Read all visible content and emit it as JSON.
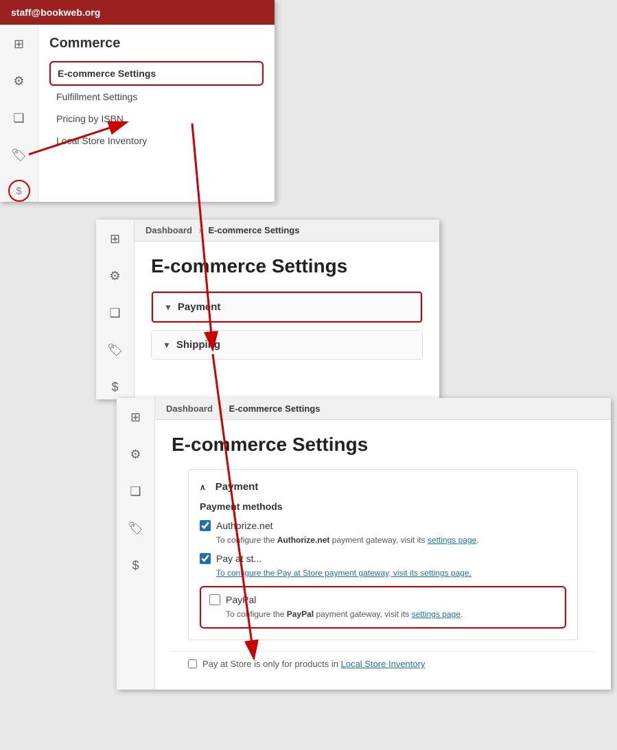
{
  "user": {
    "email": "staff@bookweb.org"
  },
  "sidebar": {
    "icons": [
      {
        "name": "grid-icon",
        "symbol": "⊞",
        "active": false
      },
      {
        "name": "cog-icon",
        "symbol": "⚙",
        "active": false
      },
      {
        "name": "file-icon",
        "symbol": "❑",
        "active": false
      },
      {
        "name": "tag-icon",
        "symbol": "🏷",
        "active": false
      },
      {
        "name": "dollar-icon",
        "symbol": "$",
        "active": true,
        "circled": true
      }
    ]
  },
  "menu": {
    "section_title": "Commerce",
    "items": [
      {
        "label": "E-commerce Settings",
        "highlighted": true
      },
      {
        "label": "Fulfillment Settings",
        "highlighted": false
      },
      {
        "label": "Pricing by ISBN",
        "highlighted": false
      },
      {
        "label": "Local Store Inventory",
        "highlighted": false
      }
    ]
  },
  "panel2": {
    "breadcrumb": {
      "parent": "Dashboard",
      "sep": "›",
      "current": "E-commerce Settings"
    },
    "title": "E-commerce Settings",
    "accordions": [
      {
        "label": "Payment",
        "icon": "▼",
        "highlighted": true
      },
      {
        "label": "Shipping",
        "icon": "▼",
        "highlighted": false
      }
    ]
  },
  "panel3": {
    "breadcrumb": {
      "parent": "Dashboard",
      "sep": "›",
      "current": "E-commerce Settings"
    },
    "title": "E-commerce Settings",
    "payment": {
      "section_title": "∧ Payment",
      "methods_title": "Payment methods",
      "methods": [
        {
          "id": "authorize",
          "label": "Authorize.net",
          "checked": true,
          "description_before": "To configure the ",
          "description_brand": "Authorize.net",
          "description_after": " payment gateway, visit its ",
          "description_link": "settings page",
          "description_end": "."
        },
        {
          "id": "pay-at-store",
          "label": "Pay at st...",
          "checked": true,
          "description_before": "To configure the ",
          "description_brand": "Pay at Store",
          "description_after": " payment gateway, visit its ",
          "description_link": "settings page",
          "description_end": "."
        },
        {
          "id": "paypal",
          "label": "PayPal",
          "checked": false,
          "highlighted": true,
          "description_before": "To configure the ",
          "description_brand": "PayPal",
          "description_after": " payment gateway, visit its ",
          "description_link": "settings page",
          "description_end": "."
        }
      ],
      "bottom_note_before": "Pay at Store is only for products in ",
      "bottom_note_link": "Local Store Inventory",
      "bottom_note_after": ""
    }
  },
  "arrows": [
    {
      "id": "arrow1",
      "from": "dollar-circle",
      "to": "ecommerce-menu-item"
    },
    {
      "id": "arrow2",
      "from": "ecommerce-menu-item",
      "to": "payment-accordion"
    },
    {
      "id": "arrow3",
      "from": "payment-accordion",
      "to": "paypal-box"
    }
  ]
}
